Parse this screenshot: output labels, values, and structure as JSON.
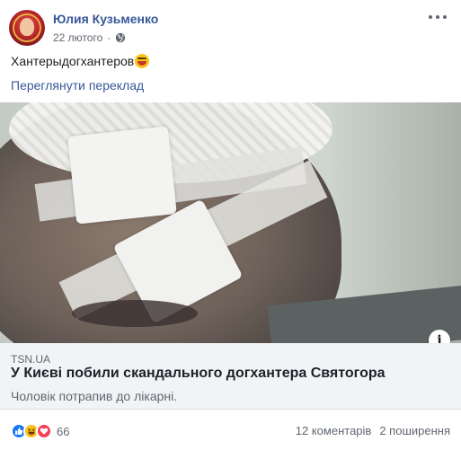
{
  "post": {
    "author": "Юлия Кузьменко",
    "date": "22 лютого",
    "separator": "·",
    "privacy_icon": "globe-icon",
    "text": "Хантерыдогхантеров",
    "text_emoji": "laughing-emoji",
    "translate_link": "Переглянути переклад",
    "more_icon": "more-options-icon"
  },
  "link_card": {
    "source": "TSN.UA",
    "headline": "У Києві побили скандального догхантера Святогора",
    "subtitle": "Чоловік потрапив до лікарні.",
    "info_icon_glyph": "i"
  },
  "footer": {
    "reaction_icons": [
      "like-icon",
      "haha-icon",
      "love-icon"
    ],
    "reaction_count": "66",
    "comments": "12 коментарів",
    "shares": "2 поширення"
  },
  "colors": {
    "link": "#385898",
    "card_bg": "#f2f3f5",
    "like": "#1877f2",
    "love": "#f33e58",
    "haha": "#fcc21b"
  }
}
